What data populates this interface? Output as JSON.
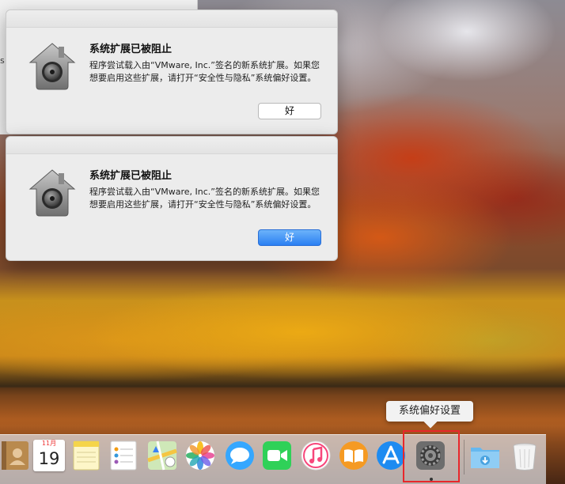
{
  "background_window": {
    "label": "s"
  },
  "alerts": [
    {
      "title": "系统扩展已被阻止",
      "message": "程序尝试载入由“VMware, Inc.”签名的新系统扩展。如果您想要启用这些扩展，请打开“安全性与隐私”系统偏好设置。",
      "button": "好",
      "button_style": "plain"
    },
    {
      "title": "系统扩展已被阻止",
      "message": "程序尝试载入由“VMware, Inc.”签名的新系统扩展。如果您想要启用这些扩展，请打开“安全性与隐私”系统偏好设置。",
      "button": "好",
      "button_style": "default"
    }
  ],
  "tooltip": "系统偏好设置",
  "dock": {
    "calendar": {
      "month": "11月",
      "day": "19"
    },
    "items": [
      "contacts-icon",
      "calendar-icon",
      "notes-icon",
      "reminders-icon",
      "maps-icon",
      "photos-icon",
      "messages-icon",
      "facetime-icon",
      "itunes-icon",
      "ibooks-icon",
      "app-store-icon",
      "system-preferences-icon",
      "downloads-stack-icon",
      "trash-icon"
    ],
    "highlighted": "system-preferences-icon"
  },
  "colors": {
    "highlight": "#e8272b",
    "default_button": "#2a7ff2"
  }
}
